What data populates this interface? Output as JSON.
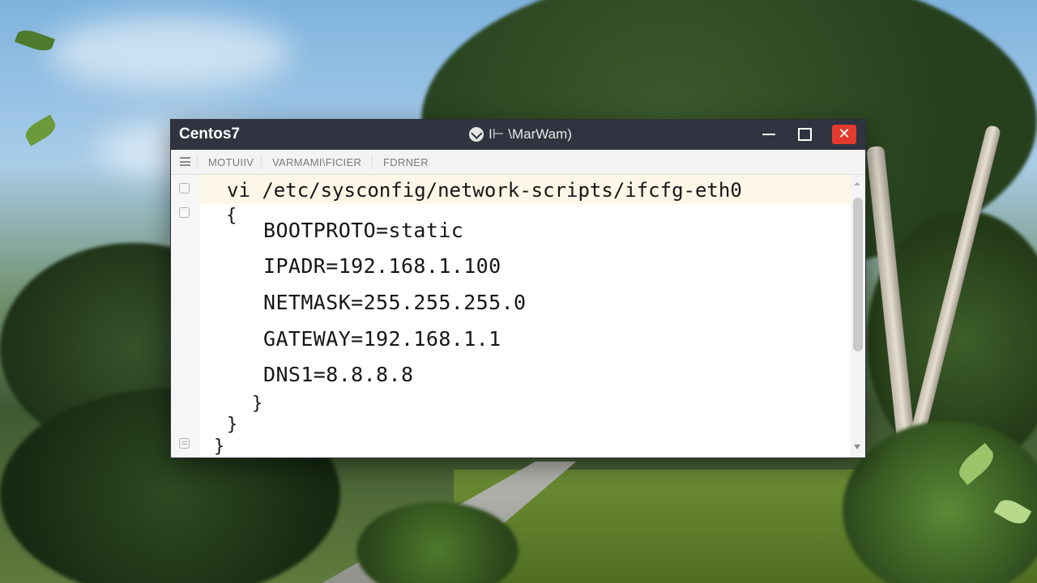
{
  "window": {
    "app_title": "Centos7",
    "center_title": "I⊢ \\MarWam)",
    "center_icon": "app-logo-icon",
    "controls": {
      "minimize": "minimize-icon",
      "maximize": "maximize-icon",
      "close": "✕"
    },
    "close_color": "#e23b2e",
    "titlebar_color": "#2f3440"
  },
  "menubar": {
    "items": [
      "MOTUIIV",
      "VARMAMI\\FICIER",
      "FDRNER"
    ]
  },
  "editor": {
    "command": "vi /etc/sysconfig/network-scripts/ifcfg-eth0",
    "open_brace": "{",
    "lines": [
      "BOOTPROTO=static",
      "IPADR=192.168.1.100",
      "NETMASK=255.255.255.0",
      "GATEWAY=192.168.1.1",
      "DNS1=8.8.8.8"
    ],
    "closing_braces": [
      "}",
      "}",
      "}"
    ],
    "highlight_color": "#fdf7e7"
  }
}
